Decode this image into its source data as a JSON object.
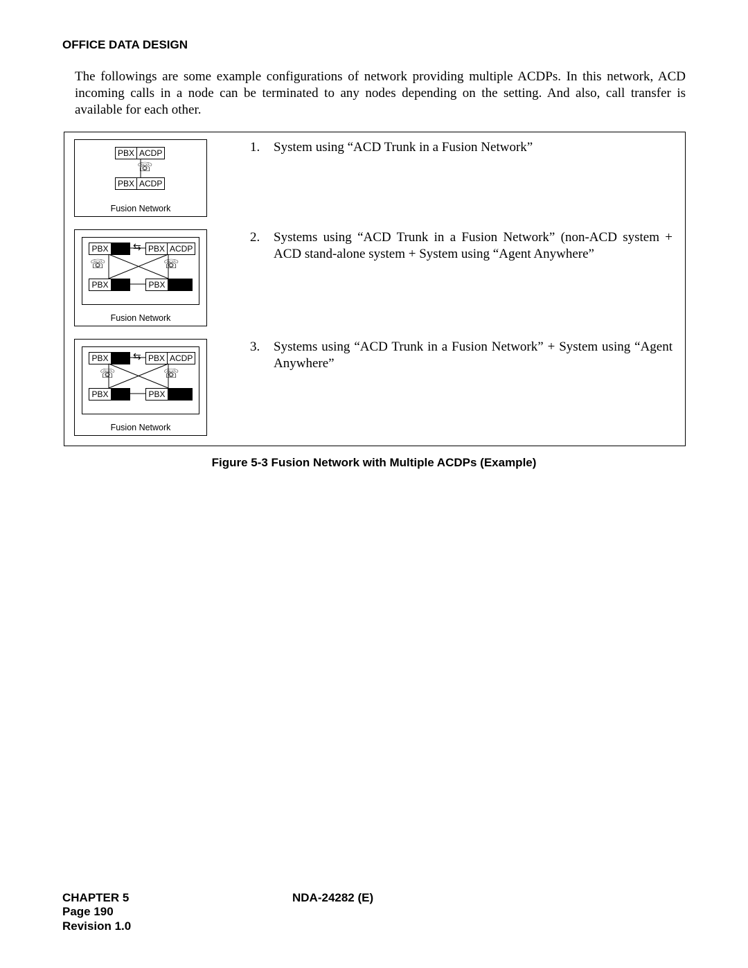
{
  "header": {
    "section": "OFFICE DATA DESIGN"
  },
  "intro": "The followings are some example configurations of network providing multiple ACDPs. In this network, ACD incoming calls in a node can be terminated to any nodes depending on the setting. And also, call transfer is available for each other.",
  "figure": {
    "fusion_label": "Fusion Network",
    "labels": {
      "pbx": "PBX",
      "acdp": "ACDP"
    },
    "items": [
      {
        "num": "1.",
        "text": "System using “ACD Trunk in a Fusion Network”"
      },
      {
        "num": "2.",
        "text": "Systems using “ACD Trunk in a Fusion Network” (non-ACD system + ACD stand-alone system + System using “Agent Anywhere”"
      },
      {
        "num": "3.",
        "text": "Systems using “ACD Trunk in a Fusion Network” + System using “Agent Anywhere”"
      }
    ],
    "caption": "Figure 5-3   Fusion Network with Multiple ACDPs (Example)"
  },
  "footer": {
    "chapter": "CHAPTER 5",
    "page": "Page 190",
    "revision": "Revision 1.0",
    "doc": "NDA-24282 (E)"
  }
}
